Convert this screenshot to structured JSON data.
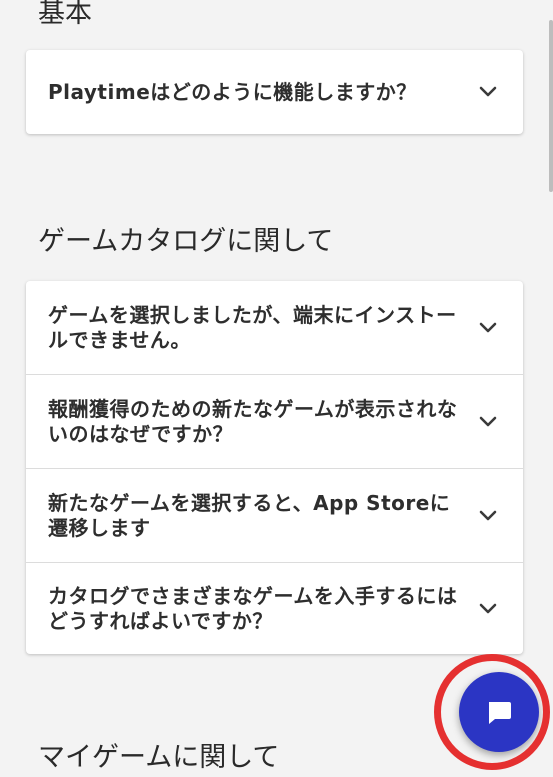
{
  "sections": {
    "basic": {
      "title": "基本",
      "items": [
        {
          "question": "Playtimeはどのように機能しますか？"
        }
      ]
    },
    "catalog": {
      "title": "ゲームカタログに関して",
      "items": [
        {
          "question": "ゲームを選択しましたが、端末にインストールできません。"
        },
        {
          "question": "報酬獲得のための新たなゲームが表示されないのはなぜですか？"
        },
        {
          "question": "新たなゲームを選択すると、App Storeに遷移します"
        },
        {
          "question": "カタログでさまざまなゲームを入手するにはどうすればよいですか？"
        }
      ]
    },
    "my_games": {
      "title": "マイゲームに関して"
    }
  },
  "colors": {
    "background": "#f3f3f3",
    "card": "#ffffff",
    "fab": "#2b35c4",
    "highlight_ring": "#e53030"
  },
  "icons": {
    "expand": "chevron-down-icon",
    "chat": "chat-bubble-icon"
  }
}
